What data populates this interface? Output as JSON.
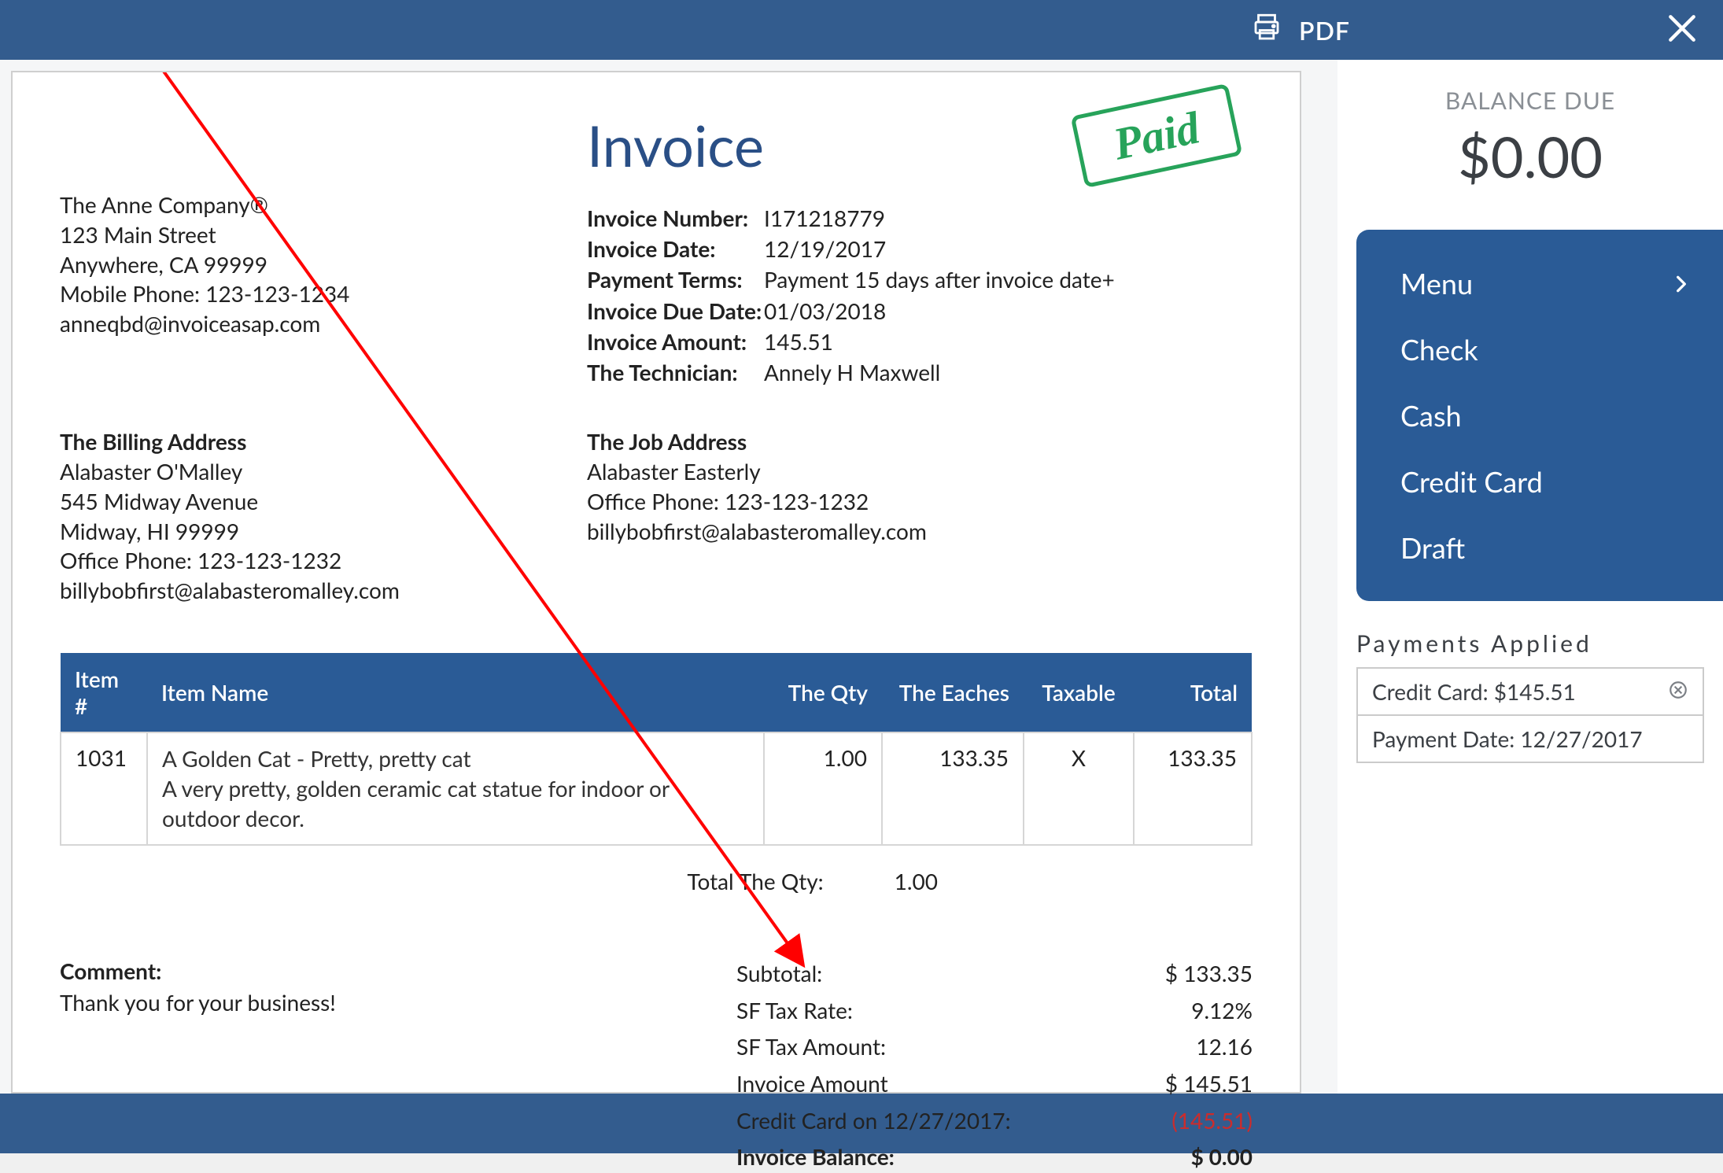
{
  "topbar": {
    "pdf_label": "PDF"
  },
  "invoice": {
    "title": "Invoice",
    "paid_stamp": "Paid",
    "company": {
      "name": "The Anne Company®",
      "addr1": "123 Main Street",
      "addr2": "Anywhere, CA 99999",
      "phone": "Mobile Phone: 123-123-1234",
      "email": "anneqbd@invoiceasap.com"
    },
    "meta": {
      "number_label": "Invoice Number:",
      "number": "I171218779",
      "date_label": "Invoice Date:",
      "date": "12/19/2017",
      "terms_label": "Payment Terms:",
      "terms": "Payment 15 days after invoice date+",
      "due_label": "Invoice Due Date:",
      "due": "01/03/2018",
      "amount_label": "Invoice Amount:",
      "amount": "145.51",
      "tech_label": "The Technician:",
      "tech": "Annely H Maxwell"
    },
    "billing": {
      "title": "The Billing Address",
      "name": "Alabaster O'Malley",
      "addr1": "545 Midway Avenue",
      "addr2": "Midway, HI 99999",
      "phone": "Office Phone: 123-123-1232",
      "email": "billybobfirst@alabasteromalley.com"
    },
    "job": {
      "title": "The Job Address",
      "name": "Alabaster Easterly",
      "phone": "Office Phone: 123-123-1232",
      "email": "billybobfirst@alabasteromalley.com"
    },
    "columns": {
      "item_no": "Item #",
      "item_name": "Item Name",
      "qty": "The Qty",
      "eaches": "The Eaches",
      "taxable": "Taxable",
      "total": "Total"
    },
    "line_item": {
      "no": "1031",
      "name": "A Golden Cat - Pretty, pretty cat",
      "desc": "A very pretty, golden ceramic cat statue for indoor or outdoor decor.",
      "qty": "1.00",
      "eaches": "133.35",
      "taxable": "X",
      "total": "133.35"
    },
    "qty_total": {
      "label": "Total The Qty:",
      "value": "1.00"
    },
    "comment": {
      "label": "Comment:",
      "text": "Thank you for your business!"
    },
    "totals": {
      "subtotal_k": "Subtotal:",
      "subtotal_v": "$ 133.35",
      "taxrate_k": "SF Tax Rate:",
      "taxrate_v": "9.12%",
      "taxamt_k": "SF Tax Amount:",
      "taxamt_v": "12.16",
      "invamt_k": "Invoice Amount",
      "invamt_v": "$ 145.51",
      "payment_k": "Credit Card on 12/27/2017:",
      "payment_v": "(145.51)",
      "balance_k": "Invoice Balance:",
      "balance_v": "$ 0.00"
    }
  },
  "sidebar": {
    "balance_due_label": "BALANCE DUE",
    "balance_due_amount": "$0.00",
    "menu": {
      "menu": "Menu",
      "check": "Check",
      "cash": "Cash",
      "credit_card": "Credit Card",
      "draft": "Draft"
    },
    "payments_applied_label": "Payments Applied",
    "payment": {
      "line1": "Credit Card: $145.51",
      "line2": "Payment Date: 12/27/2017"
    }
  }
}
